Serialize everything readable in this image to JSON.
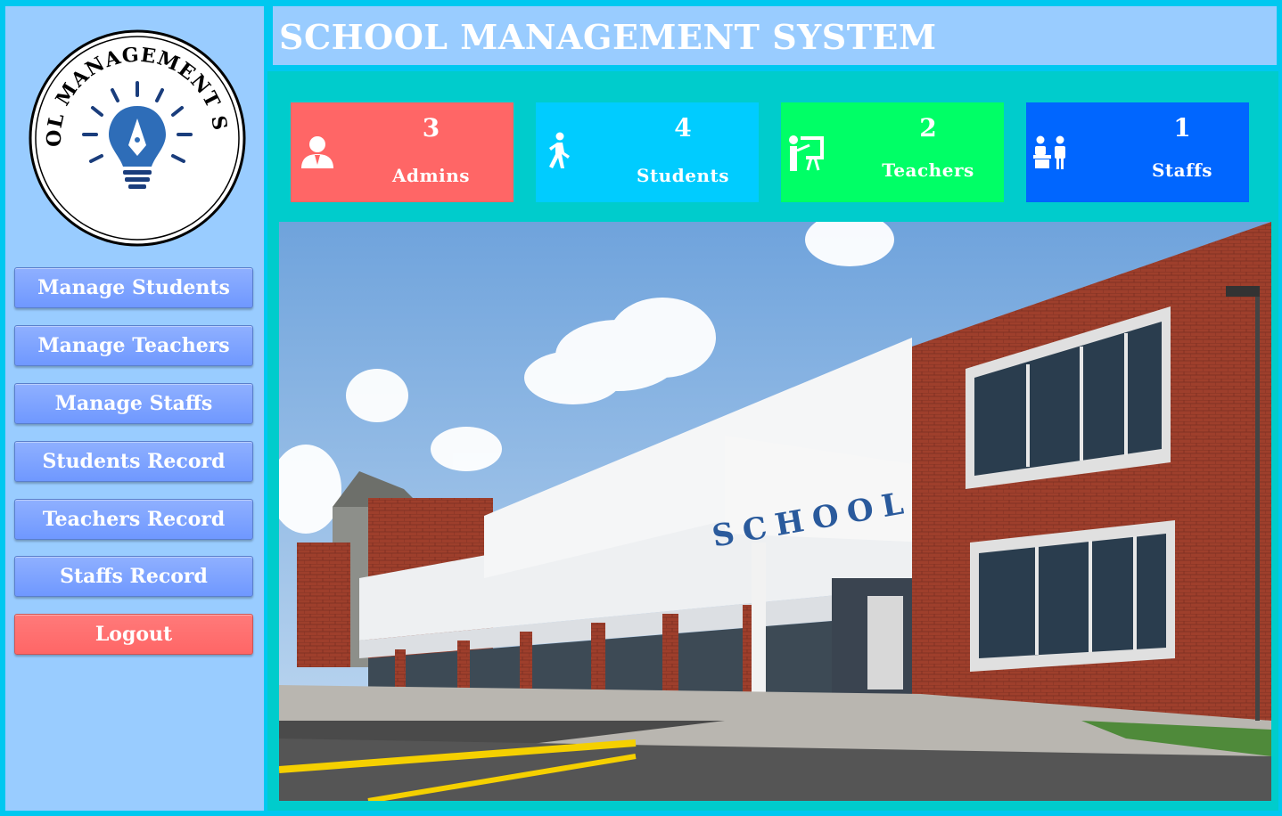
{
  "app": {
    "title": "SCHOOL MANAGEMENT SYSTEM",
    "logo_text": "SCHOOL MANAGEMENT SYSTEM"
  },
  "sidebar": {
    "items": [
      {
        "label": "Manage Students"
      },
      {
        "label": "Manage Teachers"
      },
      {
        "label": "Manage Staffs"
      },
      {
        "label": "Students Record"
      },
      {
        "label": "Teachers Record"
      },
      {
        "label": "Staffs Record"
      }
    ],
    "logout_label": "Logout"
  },
  "stats": [
    {
      "count": "3",
      "label": "Admins",
      "color": "#ff6666",
      "icon": "admin-icon"
    },
    {
      "count": "4",
      "label": "Students",
      "color": "#00ccff",
      "icon": "student-walking-icon"
    },
    {
      "count": "2",
      "label": "Teachers",
      "color": "#00ff66",
      "icon": "teacher-board-icon"
    },
    {
      "count": "1",
      "label": "Staffs",
      "color": "#0066ff",
      "icon": "staff-desk-icon"
    }
  ],
  "photo": {
    "sign_text": "SCHOOL"
  },
  "colors": {
    "background": "#00c8f0",
    "panel": "#99ccff",
    "main": "#00cccc",
    "nav_button": "#7fa6ff",
    "logout_button": "#ff6666"
  }
}
